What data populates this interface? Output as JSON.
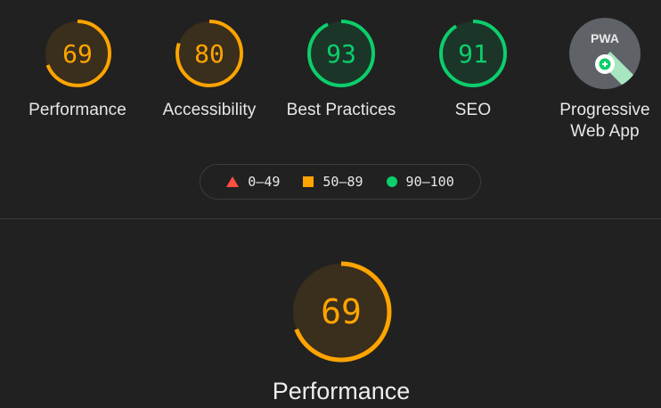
{
  "colors": {
    "fail": "#ff4e42",
    "average": "#ffa400",
    "pass": "#0cce6b",
    "pwa_badge": "#9aa0a6"
  },
  "gauges": [
    {
      "label": "Performance",
      "score": 69,
      "rating": "average"
    },
    {
      "label": "Accessibility",
      "score": 80,
      "rating": "average"
    },
    {
      "label": "Best Practices",
      "score": 93,
      "rating": "pass"
    },
    {
      "label": "SEO",
      "score": 91,
      "rating": "pass"
    }
  ],
  "pwa": {
    "label_line1": "Progressive",
    "label_line2": "Web App",
    "badge_text": "PWA",
    "icon": "pwa-badge-icon"
  },
  "legend": {
    "fail": {
      "range": "0–49",
      "icon": "triangle"
    },
    "average": {
      "range": "50–89",
      "icon": "square"
    },
    "pass": {
      "range": "90–100",
      "icon": "circle"
    }
  },
  "main": {
    "category": "Performance",
    "score": 69,
    "rating": "average"
  }
}
